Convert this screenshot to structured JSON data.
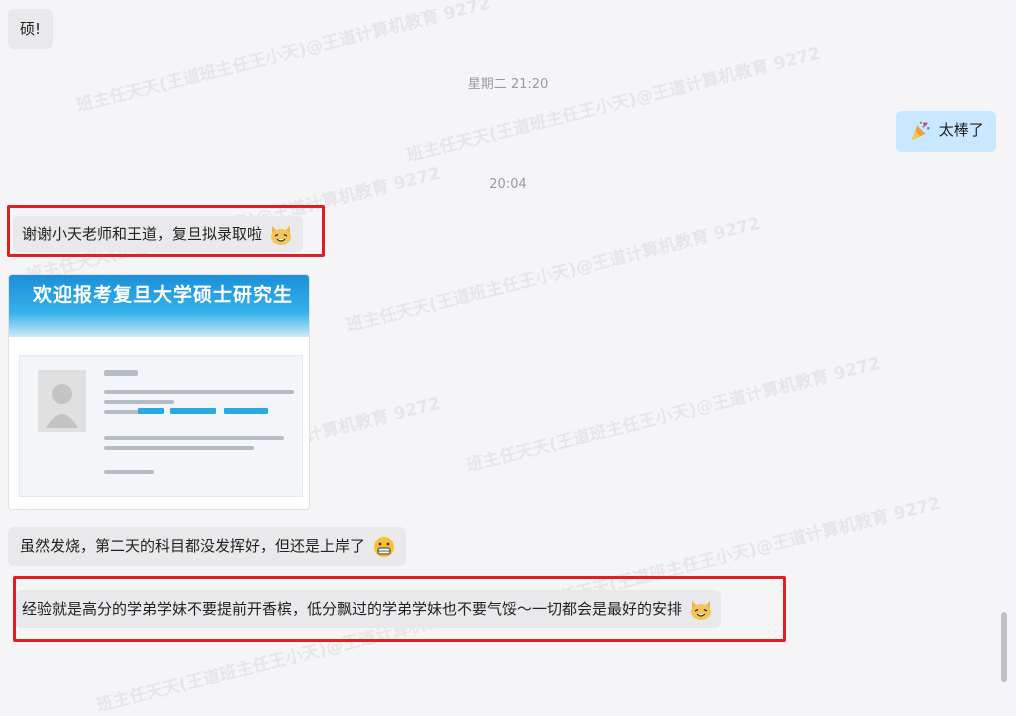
{
  "messages": {
    "m1": "硕!",
    "ts1": "星期二 21:20",
    "m2": "太棒了",
    "ts2": "20:04",
    "m3": "谢谢小天老师和王道，复旦拟录取啦",
    "card_title": "欢迎报考复旦大学硕士研究生",
    "m4": "虽然发烧，第二天的科目都没发挥好，但还是上岸了",
    "m5": "经验就是高分的学弟学妹不要提前开香槟，低分飘过的学弟学妹也不要气馁～一切都会是最好的安排"
  },
  "watermark_text": "班主任天天(王道班主任王小天)@王道计算机教育 9272",
  "colors": {
    "incoming_bubble": "#e9e9eb",
    "outgoing_bubble": "#c9e7ff",
    "highlight": "#e02020"
  },
  "icons": [
    "party-popper-emoji",
    "cat-face-emoji",
    "grinning-face-emoji"
  ]
}
